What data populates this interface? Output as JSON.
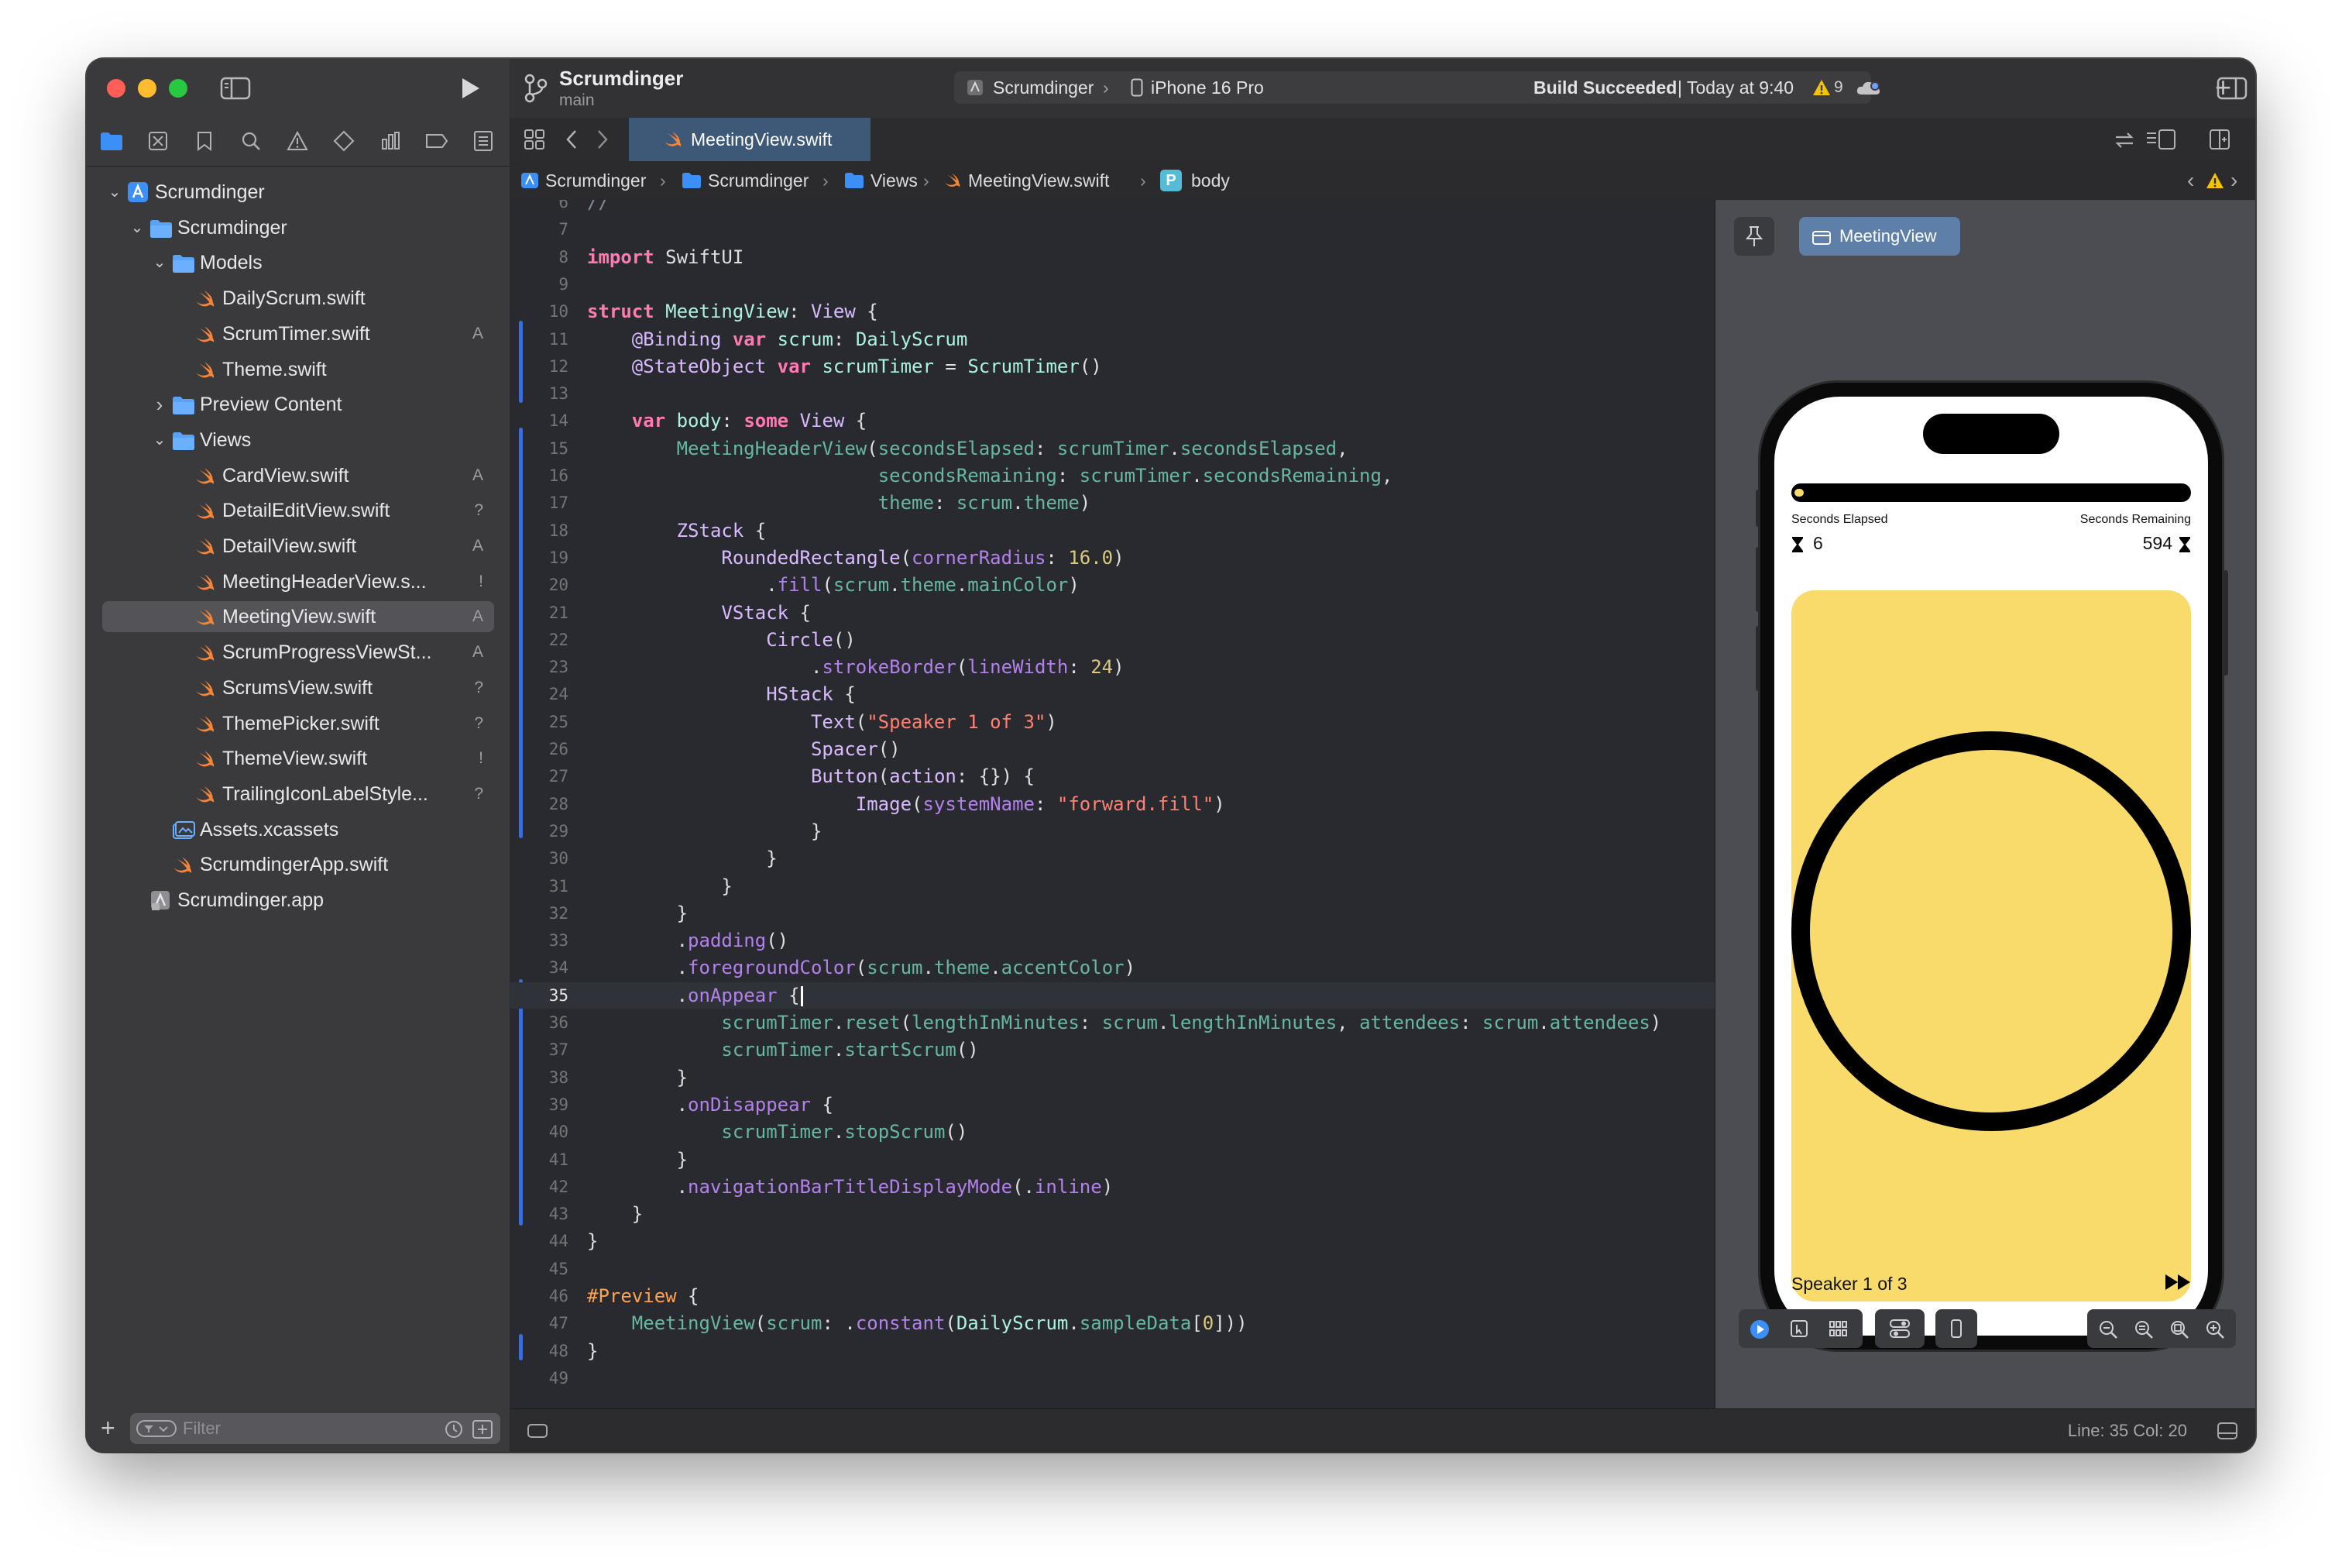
{
  "sidebar": {
    "filter_placeholder": "Filter",
    "tree": [
      {
        "label": "Scrumdinger",
        "level": 0,
        "icon": "xcode-project-icon",
        "expanded": true,
        "badge": ""
      },
      {
        "label": "Scrumdinger",
        "level": 1,
        "icon": "folder-icon",
        "expanded": true,
        "badge": ""
      },
      {
        "label": "Models",
        "level": 2,
        "icon": "folder-icon",
        "expanded": true,
        "badge": ""
      },
      {
        "label": "DailyScrum.swift",
        "level": 3,
        "icon": "swift-file-icon",
        "badge": ""
      },
      {
        "label": "ScrumTimer.swift",
        "level": 3,
        "icon": "swift-file-icon",
        "badge": "A"
      },
      {
        "label": "Theme.swift",
        "level": 3,
        "icon": "swift-file-icon",
        "badge": ""
      },
      {
        "label": "Preview Content",
        "level": 2,
        "icon": "folder-icon",
        "expanded": false,
        "badge": ""
      },
      {
        "label": "Views",
        "level": 2,
        "icon": "folder-icon",
        "expanded": true,
        "badge": ""
      },
      {
        "label": "CardView.swift",
        "level": 3,
        "icon": "swift-file-icon",
        "badge": "A"
      },
      {
        "label": "DetailEditView.swift",
        "level": 3,
        "icon": "swift-file-icon",
        "badge": "?"
      },
      {
        "label": "DetailView.swift",
        "level": 3,
        "icon": "swift-file-icon",
        "badge": "A"
      },
      {
        "label": "MeetingHeaderView.s...",
        "level": 3,
        "icon": "swift-file-icon",
        "badge": "!"
      },
      {
        "label": "MeetingView.swift",
        "level": 3,
        "icon": "swift-file-icon",
        "badge": "A",
        "selected": true
      },
      {
        "label": "ScrumProgressViewSt...",
        "level": 3,
        "icon": "swift-file-icon",
        "badge": "A"
      },
      {
        "label": "ScrumsView.swift",
        "level": 3,
        "icon": "swift-file-icon",
        "badge": "?"
      },
      {
        "label": "ThemePicker.swift",
        "level": 3,
        "icon": "swift-file-icon",
        "badge": "?"
      },
      {
        "label": "ThemeView.swift",
        "level": 3,
        "icon": "swift-file-icon",
        "badge": "!"
      },
      {
        "label": "TrailingIconLabelStyle...",
        "level": 3,
        "icon": "swift-file-icon",
        "badge": "?"
      },
      {
        "label": "Assets.xcassets",
        "level": 2,
        "icon": "asset-catalog-icon",
        "badge": ""
      },
      {
        "label": "ScrumdingerApp.swift",
        "level": 2,
        "icon": "swift-file-icon",
        "badge": ""
      },
      {
        "label": "Scrumdinger.app",
        "level": 1,
        "icon": "app-product-icon",
        "badge": ""
      }
    ]
  },
  "toolbar": {
    "project_name": "Scrumdinger",
    "branch": "main",
    "scheme": "Scrumdinger",
    "destination": "iPhone 16 Pro",
    "build_status": "Build Succeeded",
    "build_time": "| Today at 9:40",
    "warning_count": "9"
  },
  "editor": {
    "tab_label": "MeetingView.swift",
    "jump_bar": [
      "Scrumdinger",
      "Scrumdinger",
      "Views",
      "MeetingView.swift",
      "body"
    ],
    "status": "Line: 35  Col: 20"
  },
  "code_lines": [
    {
      "n": "6",
      "tokens": [
        [
          "cm",
          "//"
        ]
      ]
    },
    {
      "n": "7",
      "tokens": []
    },
    {
      "n": "8",
      "tokens": [
        [
          "kw",
          "import"
        ],
        [
          "",
          " SwiftUI"
        ]
      ]
    },
    {
      "n": "9",
      "tokens": []
    },
    {
      "n": "10",
      "tokens": [
        [
          "kw",
          "struct"
        ],
        [
          "",
          " "
        ],
        [
          "tp",
          "MeetingView"
        ],
        [
          "",
          ": "
        ],
        [
          "ty",
          "View"
        ],
        [
          "",
          " {"
        ]
      ]
    },
    {
      "n": "11",
      "tokens": [
        [
          "",
          "    "
        ],
        [
          "ty",
          "@Binding"
        ],
        [
          "",
          " "
        ],
        [
          "kw",
          "var"
        ],
        [
          "",
          " "
        ],
        [
          "tp",
          "scrum"
        ],
        [
          "",
          ": "
        ],
        [
          "tp",
          "DailyScrum"
        ]
      ]
    },
    {
      "n": "12",
      "tokens": [
        [
          "",
          "    "
        ],
        [
          "ty",
          "@StateObject"
        ],
        [
          "",
          " "
        ],
        [
          "kw",
          "var"
        ],
        [
          "",
          " "
        ],
        [
          "tp",
          "scrumTimer"
        ],
        [
          "",
          " = "
        ],
        [
          "tp",
          "ScrumTimer"
        ],
        [
          "",
          "()"
        ]
      ]
    },
    {
      "n": "13",
      "tokens": []
    },
    {
      "n": "14",
      "tokens": [
        [
          "",
          "    "
        ],
        [
          "kw",
          "var"
        ],
        [
          "",
          " "
        ],
        [
          "tp",
          "body"
        ],
        [
          "",
          ": "
        ],
        [
          "kw",
          "some"
        ],
        [
          "",
          " "
        ],
        [
          "ty",
          "View"
        ],
        [
          "",
          " {"
        ]
      ]
    },
    {
      "n": "15",
      "tokens": [
        [
          "",
          "        "
        ],
        [
          "fn",
          "MeetingHeaderView"
        ],
        [
          "",
          "("
        ],
        [
          "fn",
          "secondsElapsed"
        ],
        [
          "",
          ": "
        ],
        [
          "fn",
          "scrumTimer"
        ],
        [
          "",
          "."
        ],
        [
          "fn",
          "secondsElapsed"
        ],
        [
          "",
          ","
        ]
      ]
    },
    {
      "n": "16",
      "tokens": [
        [
          "",
          "                          "
        ],
        [
          "fn",
          "secondsRemaining"
        ],
        [
          "",
          ": "
        ],
        [
          "fn",
          "scrumTimer"
        ],
        [
          "",
          "."
        ],
        [
          "fn",
          "secondsRemaining"
        ],
        [
          "",
          ","
        ]
      ]
    },
    {
      "n": "17",
      "tokens": [
        [
          "",
          "                          "
        ],
        [
          "fn",
          "theme"
        ],
        [
          "",
          ": "
        ],
        [
          "fn",
          "scrum"
        ],
        [
          "",
          "."
        ],
        [
          "fn",
          "theme"
        ],
        [
          "",
          ")"
        ]
      ]
    },
    {
      "n": "18",
      "tokens": [
        [
          "",
          "        "
        ],
        [
          "ty",
          "ZStack"
        ],
        [
          "",
          " {"
        ]
      ]
    },
    {
      "n": "19",
      "tokens": [
        [
          "",
          "            "
        ],
        [
          "ty",
          "RoundedRectangle"
        ],
        [
          "",
          "("
        ],
        [
          "pr",
          "cornerRadius"
        ],
        [
          "",
          ": "
        ],
        [
          "nm",
          "16.0"
        ],
        [
          "",
          ")"
        ]
      ]
    },
    {
      "n": "20",
      "tokens": [
        [
          "",
          "                ."
        ],
        [
          "pr",
          "fill"
        ],
        [
          "",
          "("
        ],
        [
          "fn",
          "scrum"
        ],
        [
          "",
          "."
        ],
        [
          "fn",
          "theme"
        ],
        [
          "",
          "."
        ],
        [
          "fn",
          "mainColor"
        ],
        [
          "",
          ")"
        ]
      ]
    },
    {
      "n": "21",
      "tokens": [
        [
          "",
          "            "
        ],
        [
          "ty",
          "VStack"
        ],
        [
          "",
          " {"
        ]
      ]
    },
    {
      "n": "22",
      "tokens": [
        [
          "",
          "                "
        ],
        [
          "ty",
          "Circle"
        ],
        [
          "",
          "()"
        ]
      ]
    },
    {
      "n": "23",
      "tokens": [
        [
          "",
          "                    ."
        ],
        [
          "pr",
          "strokeBorder"
        ],
        [
          "",
          "("
        ],
        [
          "pr",
          "lineWidth"
        ],
        [
          "",
          ": "
        ],
        [
          "nm",
          "24"
        ],
        [
          "",
          ")"
        ]
      ]
    },
    {
      "n": "24",
      "tokens": [
        [
          "",
          "                "
        ],
        [
          "ty",
          "HStack"
        ],
        [
          "",
          " {"
        ]
      ]
    },
    {
      "n": "25",
      "tokens": [
        [
          "",
          "                    "
        ],
        [
          "ty",
          "Text"
        ],
        [
          "",
          "("
        ],
        [
          "st",
          "\"Speaker 1 of 3\""
        ],
        [
          "",
          ")"
        ]
      ]
    },
    {
      "n": "26",
      "tokens": [
        [
          "",
          "                    "
        ],
        [
          "ty",
          "Spacer"
        ],
        [
          "",
          "()"
        ]
      ]
    },
    {
      "n": "27",
      "tokens": [
        [
          "",
          "                    "
        ],
        [
          "ty",
          "Button"
        ],
        [
          "",
          "("
        ],
        [
          "ty",
          "action"
        ],
        [
          "",
          ": {}) {"
        ]
      ]
    },
    {
      "n": "28",
      "tokens": [
        [
          "",
          "                        "
        ],
        [
          "ty",
          "Image"
        ],
        [
          "",
          "("
        ],
        [
          "pr",
          "systemName"
        ],
        [
          "",
          ": "
        ],
        [
          "st",
          "\"forward.fill\""
        ],
        [
          "",
          ")"
        ]
      ]
    },
    {
      "n": "29",
      "tokens": [
        [
          "",
          "                    }"
        ]
      ]
    },
    {
      "n": "30",
      "tokens": [
        [
          "",
          "                }"
        ]
      ]
    },
    {
      "n": "31",
      "tokens": [
        [
          "",
          "            }"
        ]
      ]
    },
    {
      "n": "32",
      "tokens": [
        [
          "",
          "        }"
        ]
      ]
    },
    {
      "n": "33",
      "tokens": [
        [
          "",
          "        ."
        ],
        [
          "pr",
          "padding"
        ],
        [
          "",
          "()"
        ]
      ]
    },
    {
      "n": "34",
      "tokens": [
        [
          "",
          "        ."
        ],
        [
          "pr",
          "foregroundColor"
        ],
        [
          "",
          "("
        ],
        [
          "fn",
          "scrum"
        ],
        [
          "",
          "."
        ],
        [
          "fn",
          "theme"
        ],
        [
          "",
          "."
        ],
        [
          "fn",
          "accentColor"
        ],
        [
          "",
          ")"
        ]
      ]
    },
    {
      "n": "35",
      "tokens": [
        [
          "",
          "        ."
        ],
        [
          "pr",
          "onAppear"
        ],
        [
          "",
          " {"
        ]
      ],
      "current": true
    },
    {
      "n": "36",
      "tokens": [
        [
          "",
          "            "
        ],
        [
          "fn",
          "scrumTimer"
        ],
        [
          "",
          "."
        ],
        [
          "fn",
          "reset"
        ],
        [
          "",
          "("
        ],
        [
          "fn",
          "lengthInMinutes"
        ],
        [
          "",
          ": "
        ],
        [
          "fn",
          "scrum"
        ],
        [
          "",
          "."
        ],
        [
          "fn",
          "lengthInMinutes"
        ],
        [
          "",
          ", "
        ],
        [
          "fn",
          "attendees"
        ],
        [
          "",
          ": "
        ],
        [
          "fn",
          "scrum"
        ],
        [
          "",
          "."
        ],
        [
          "fn",
          "attendees"
        ],
        [
          "",
          ")"
        ]
      ]
    },
    {
      "n": "37",
      "tokens": [
        [
          "",
          "            "
        ],
        [
          "fn",
          "scrumTimer"
        ],
        [
          "",
          "."
        ],
        [
          "fn",
          "startScrum"
        ],
        [
          "",
          "()"
        ]
      ]
    },
    {
      "n": "38",
      "tokens": [
        [
          "",
          "        }"
        ]
      ]
    },
    {
      "n": "39",
      "tokens": [
        [
          "",
          "        ."
        ],
        [
          "pr",
          "onDisappear"
        ],
        [
          "",
          " {"
        ]
      ]
    },
    {
      "n": "40",
      "tokens": [
        [
          "",
          "            "
        ],
        [
          "fn",
          "scrumTimer"
        ],
        [
          "",
          "."
        ],
        [
          "fn",
          "stopScrum"
        ],
        [
          "",
          "()"
        ]
      ]
    },
    {
      "n": "41",
      "tokens": [
        [
          "",
          "        }"
        ]
      ]
    },
    {
      "n": "42",
      "tokens": [
        [
          "",
          "        ."
        ],
        [
          "pr",
          "navigationBarTitleDisplayMode"
        ],
        [
          "",
          "(."
        ],
        [
          "pr",
          "inline"
        ],
        [
          "",
          ")"
        ]
      ]
    },
    {
      "n": "43",
      "tokens": [
        [
          "",
          "    }"
        ]
      ]
    },
    {
      "n": "44",
      "tokens": [
        [
          "",
          "}"
        ]
      ]
    },
    {
      "n": "45",
      "tokens": []
    },
    {
      "n": "46",
      "tokens": [
        [
          "pp",
          "#Preview"
        ],
        [
          "",
          " {"
        ]
      ]
    },
    {
      "n": "47",
      "tokens": [
        [
          "",
          "    "
        ],
        [
          "fn",
          "MeetingView"
        ],
        [
          "",
          "("
        ],
        [
          "fn",
          "scrum"
        ],
        [
          "",
          ": ."
        ],
        [
          "pr",
          "constant"
        ],
        [
          "",
          "("
        ],
        [
          "tp",
          "DailyScrum"
        ],
        [
          "",
          "."
        ],
        [
          "fn",
          "sampleData"
        ],
        [
          "",
          "["
        ],
        [
          "nm",
          "0"
        ],
        [
          "",
          "]))"
        ]
      ]
    },
    {
      "n": "48",
      "tokens": [
        [
          "",
          "}"
        ]
      ]
    },
    {
      "n": "49",
      "tokens": []
    }
  ],
  "preview": {
    "label": "MeetingView",
    "seconds_elapsed_label": "Seconds Elapsed",
    "seconds_elapsed": "6",
    "seconds_remaining_label": "Seconds Remaining",
    "seconds_remaining": "594",
    "progress_fraction": 0.01,
    "speaker_text": "Speaker 1 of 3",
    "card_color": "#f8db6a"
  },
  "colors": {
    "accent": "#3e5878",
    "warning": "#f5c400"
  }
}
